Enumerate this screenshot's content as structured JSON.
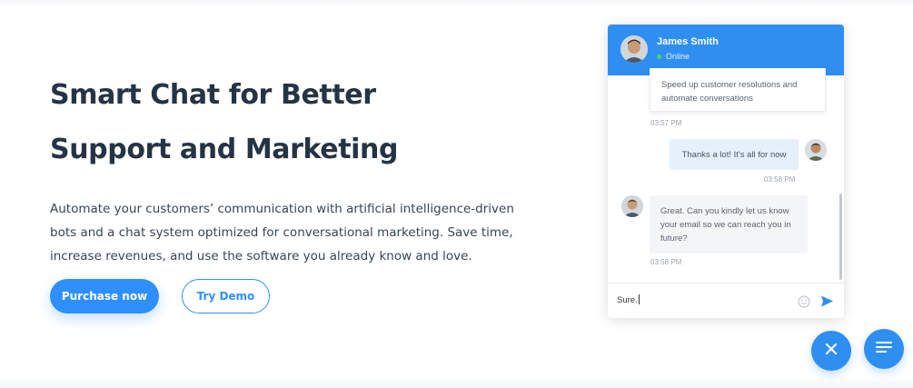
{
  "hero": {
    "title_line1": "Smart Chat for Better",
    "title_line2": "Support and Marketing",
    "description": "Automate your customers’ communication with artificial intelligence-driven bots and a chat system optimized for conversational marketing. Save time, increase revenues, and use the software you already know and love.",
    "primary_button": "Purchase now",
    "secondary_button": "Try Demo"
  },
  "chat": {
    "agent_name": "James Smith",
    "status": "Online",
    "messages": [
      {
        "from": "agent",
        "text": "Speed up customer resolutions and automate conversations",
        "time": "03:57 PM"
      },
      {
        "from": "user",
        "text": "Thanks a lot! It's all for now",
        "time": "03:58 PM"
      },
      {
        "from": "agent",
        "text": "Great. Can you kindly let us know your email so we can reach you in future?",
        "time": "03:58 PM"
      }
    ],
    "input_value": "Sure.",
    "icons": {
      "emoji": "emoji-icon",
      "send": "send-icon",
      "close": "close-icon",
      "menu": "menu-icon"
    }
  },
  "colors": {
    "accent": "#2f8ff0",
    "heading": "#253445",
    "online": "#40d67a"
  }
}
